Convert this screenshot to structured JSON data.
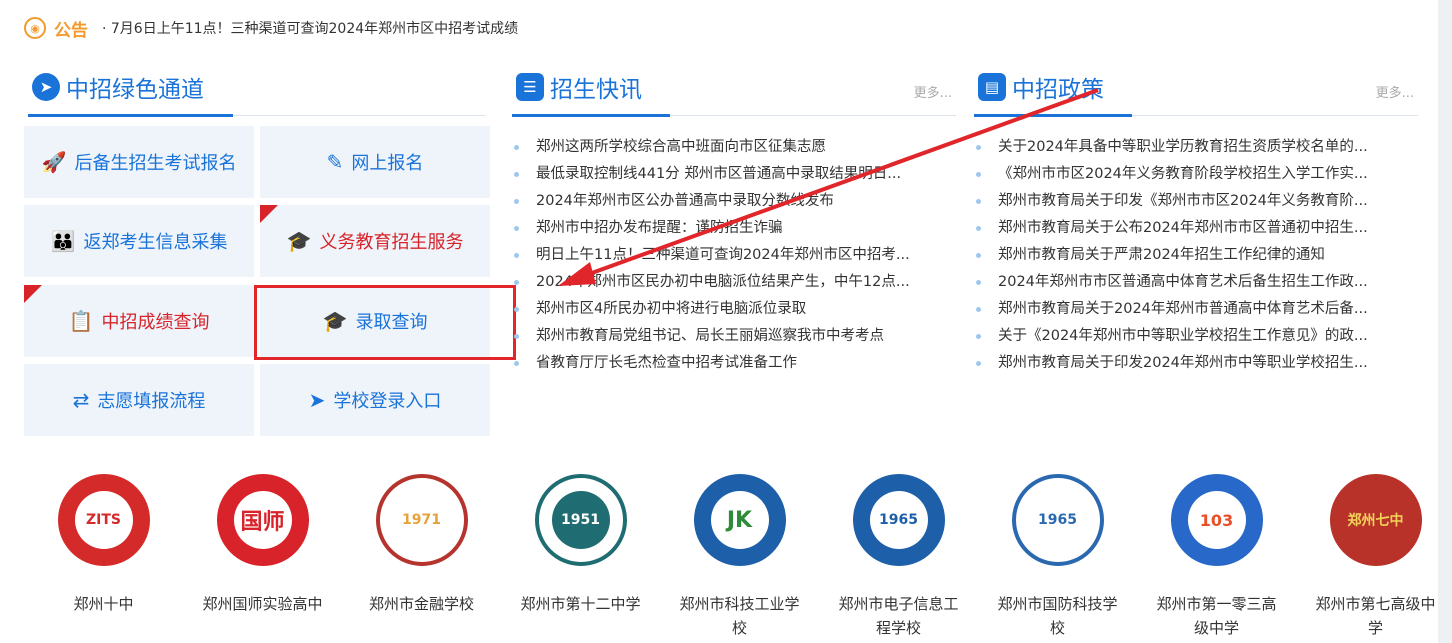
{
  "notice": {
    "title": "公告",
    "text": "· 7月6日上午11点！三种渠道可查询2024年郑州市区中招考试成绩"
  },
  "sections": {
    "green": {
      "title": "中招绿色通道"
    },
    "news": {
      "title": "招生快讯",
      "more": "更多..."
    },
    "policy": {
      "title": "中招政策",
      "more": "更多..."
    }
  },
  "tiles": [
    {
      "label": "后备生招生考试报名",
      "icon": "rocket-icon",
      "color": "#1a73d9"
    },
    {
      "label": "网上报名",
      "icon": "edit-icon",
      "color": "#1a73d9"
    },
    {
      "label": "返郑考生信息采集",
      "icon": "people-icon",
      "color": "#1a73d9"
    },
    {
      "label": "义务教育招生服务",
      "icon": "graduate-icon",
      "color": "#d8232a"
    },
    {
      "label": "中招成绩查询",
      "icon": "report-search-icon",
      "color": "#d8232a"
    },
    {
      "label": "录取查询",
      "icon": "mortarboard-icon",
      "color": "#1a73d9"
    },
    {
      "label": "志愿填报流程",
      "icon": "flow-icon",
      "color": "#1a73d9"
    },
    {
      "label": "学校登录入口",
      "icon": "send-icon",
      "color": "#1a73d9"
    }
  ],
  "news_items": [
    "郑州这两所学校综合高中班面向市区征集志愿",
    "最低录取控制线441分 郑州市区普通高中录取结果明日...",
    "2024年郑州市区公办普通高中录取分数线发布",
    "郑州市中招办发布提醒：谨防招生诈骗",
    "明日上午11点！三种渠道可查询2024年郑州市区中招考...",
    "2024年郑州市区民办初中电脑派位结果产生，中午12点...",
    "郑州市区4所民办初中将进行电脑派位录取",
    "郑州市教育局党组书记、局长王丽娟巡察我市中考考点",
    "省教育厅厅长毛杰检查中招考试准备工作"
  ],
  "policy_items": [
    "关于2024年具备中等职业学历教育招生资质学校名单的...",
    "《郑州市市区2024年义务教育阶段学校招生入学工作实...",
    "郑州市教育局关于印发《郑州市市区2024年义务教育阶...",
    "郑州市教育局关于公布2024年郑州市市区普通初中招生...",
    "郑州市教育局关于严肃2024年招生工作纪律的通知",
    "2024年郑州市市区普通高中体育艺术后备生招生工作政...",
    "郑州市教育局关于2024年郑州市普通高中体育艺术后备...",
    "关于《2024年郑州市中等职业学校招生工作意见》的政...",
    "郑州市教育局关于印发2024年郑州市中等职业学校招生..."
  ],
  "schools": [
    {
      "name": "郑州十中",
      "color": "#d42a2a",
      "glyph": "ZITS"
    },
    {
      "name": "郑州国师实验高中",
      "color": "#d8232a",
      "glyph": "国师"
    },
    {
      "name": "郑州市金融学校",
      "color": "#b5342d",
      "glyph": "1971"
    },
    {
      "name": "郑州市第十二中学",
      "color": "#1f6d72",
      "glyph": "1951"
    },
    {
      "name": "郑州市科技工业学校",
      "color": "#2e8b3a",
      "glyph": "JK"
    },
    {
      "name": "郑州市电子信息工程学校",
      "color": "#1d5fa8",
      "glyph": "1965"
    },
    {
      "name": "郑州市国防科技学校",
      "color": "#2a68b0",
      "glyph": "1965"
    },
    {
      "name": "郑州市第一零三高级中学",
      "color": "#2868c8",
      "glyph": "103"
    },
    {
      "name": "郑州市第七高级中学",
      "color": "#b8322a",
      "glyph": "郑州七中"
    }
  ]
}
